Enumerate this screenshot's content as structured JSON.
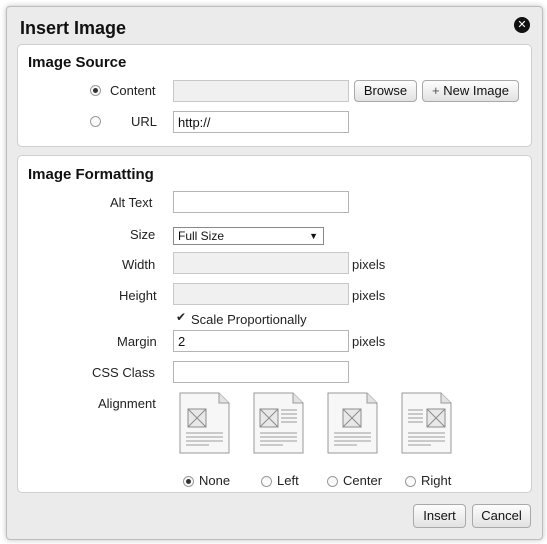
{
  "dialog": {
    "title": "Insert Image",
    "close_icon": "close-circle-icon"
  },
  "source": {
    "title": "Image Source",
    "content_label": "Content",
    "content_selected": true,
    "browse_label": "Browse",
    "new_image_label": "New Image",
    "new_image_icon": "plus-icon",
    "url_label": "URL",
    "url_value": "http://"
  },
  "formatting": {
    "title": "Image Formatting",
    "alt_text_label": "Alt Text",
    "alt_text_value": "",
    "size_label": "Size",
    "size_value": "Full Size",
    "width_label": "Width",
    "width_value": "",
    "height_label": "Height",
    "height_value": "",
    "pixels_label": "pixels",
    "scale_label": "Scale Proportionally",
    "scale_checked": true,
    "margin_label": "Margin",
    "margin_value": "2",
    "css_class_label": "CSS Class",
    "css_class_value": "",
    "alignment_label": "Alignment",
    "alignments": [
      {
        "label": "None",
        "selected": true
      },
      {
        "label": "Left",
        "selected": false
      },
      {
        "label": "Center",
        "selected": false
      },
      {
        "label": "Right",
        "selected": false
      }
    ]
  },
  "footer": {
    "insert_label": "Insert",
    "cancel_label": "Cancel"
  }
}
